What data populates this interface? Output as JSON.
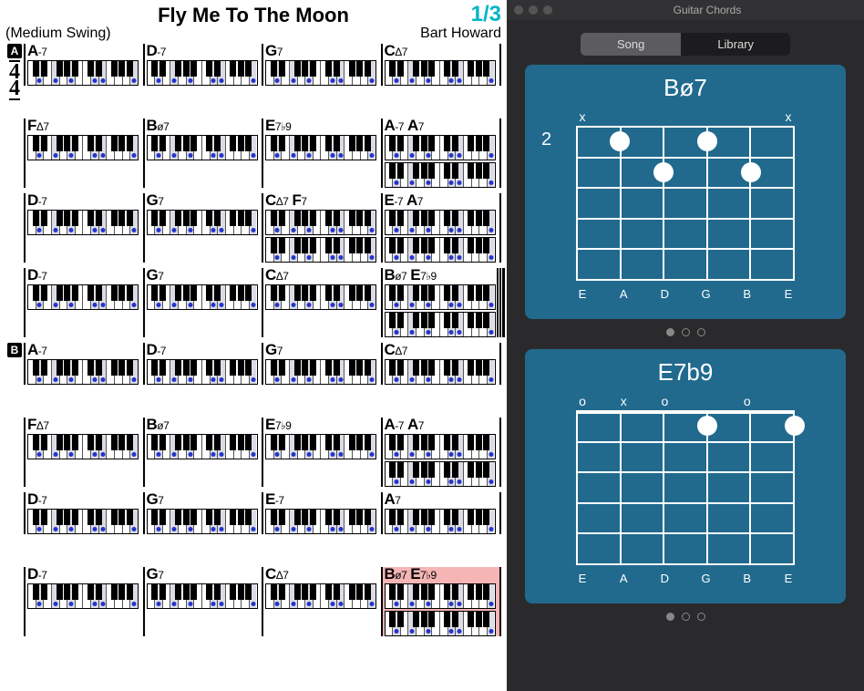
{
  "sheet": {
    "title": "Fly Me To The Moon",
    "page": "1/3",
    "style": "(Medium Swing)",
    "composer": "Bart Howard",
    "time_sig": {
      "num": "4",
      "den": "4"
    },
    "sections": [
      {
        "rehearsal": "A",
        "rows": [
          [
            [
              "A-7"
            ],
            [
              "D-7"
            ],
            [
              "G7"
            ],
            [
              "CΔ7"
            ]
          ],
          [
            [
              "FΔ7"
            ],
            [
              "Bø7"
            ],
            [
              "E7♭9"
            ],
            [
              "A-7",
              "A7"
            ]
          ],
          [
            [
              "D-7"
            ],
            [
              "G7"
            ],
            [
              "CΔ7",
              "F7"
            ],
            [
              "E-7",
              "A7"
            ]
          ],
          [
            [
              "D-7"
            ],
            [
              "G7"
            ],
            [
              "CΔ7"
            ],
            [
              "Bø7",
              "E7♭9"
            ]
          ]
        ]
      },
      {
        "rehearsal": "B",
        "rows": [
          [
            [
              "A-7"
            ],
            [
              "D-7"
            ],
            [
              "G7"
            ],
            [
              "CΔ7"
            ]
          ],
          [
            [
              "FΔ7"
            ],
            [
              "Bø7"
            ],
            [
              "E7♭9"
            ],
            [
              "A-7",
              "A7"
            ]
          ],
          [
            [
              "D-7"
            ],
            [
              "G7"
            ],
            [
              "E-7"
            ],
            [
              "A7"
            ]
          ],
          [
            [
              "D-7"
            ],
            [
              "G7"
            ],
            [
              "CΔ7"
            ],
            [
              "Bø7",
              "E7♭9"
            ]
          ]
        ]
      }
    ]
  },
  "panel": {
    "window_title": "Guitar Chords",
    "tabs": {
      "song": "Song",
      "library": "Library",
      "active": "song"
    },
    "string_names": [
      "E",
      "A",
      "D",
      "G",
      "B",
      "E"
    ],
    "chords": [
      {
        "name": "Bø7",
        "fret_label": "2",
        "markers": [
          "x",
          "",
          "",
          "",
          "",
          "x"
        ],
        "fingers": [
          {
            "string": 1,
            "fret": 1
          },
          {
            "string": 2,
            "fret": 2
          },
          {
            "string": 3,
            "fret": 1
          },
          {
            "string": 4,
            "fret": 2
          }
        ],
        "nut_thin": true,
        "page_dots": 3,
        "active_dot": 0
      },
      {
        "name": "E7b9",
        "fret_label": "",
        "markers": [
          "o",
          "x",
          "o",
          "",
          "o",
          ""
        ],
        "fingers": [
          {
            "string": 3,
            "fret": 1
          },
          {
            "string": 5,
            "fret": 1
          }
        ],
        "nut_thin": false,
        "page_dots": 3,
        "active_dot": 0
      }
    ]
  }
}
